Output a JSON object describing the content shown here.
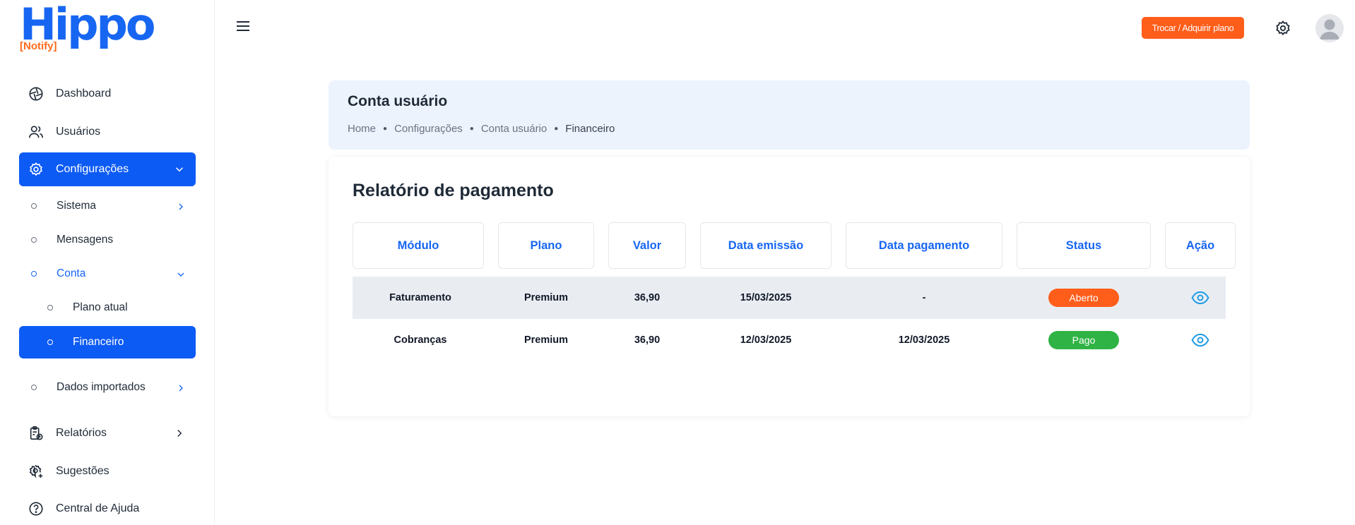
{
  "brand": {
    "name": "Hippo",
    "sub": "[Notify]"
  },
  "sidebar": {
    "items": [
      {
        "label": "Dashboard"
      },
      {
        "label": "Usuários"
      },
      {
        "label": "Configurações"
      },
      {
        "label": "Relatórios"
      },
      {
        "label": "Sugestões"
      },
      {
        "label": "Central de Ajuda"
      }
    ],
    "config_sub": {
      "sistema": "Sistema",
      "mensagens": "Mensagens",
      "conta": "Conta",
      "plano_atual": "Plano atual",
      "financeiro": "Financeiro",
      "dados_importados": "Dados importados"
    }
  },
  "header": {
    "cta_label": "Trocar / Adquirir plano"
  },
  "page": {
    "title": "Conta usuário",
    "breadcrumb": [
      "Home",
      "Configurações",
      "Conta usuário",
      "Financeiro"
    ]
  },
  "report": {
    "title": "Relatório de pagamento",
    "columns": [
      "Módulo",
      "Plano",
      "Valor",
      "Data emissão",
      "Data pagamento",
      "Status",
      "Ação"
    ],
    "rows": [
      {
        "modulo": "Faturamento",
        "plano": "Premium",
        "valor": "36,90",
        "emissao": "15/03/2025",
        "pagamento": "-",
        "status": "Aberto",
        "status_color": "#ff5d1a"
      },
      {
        "modulo": "Cobranças",
        "plano": "Premium",
        "valor": "36,90",
        "emissao": "12/03/2025",
        "pagamento": "12/03/2025",
        "status": "Pago",
        "status_color": "#2fb344"
      }
    ]
  },
  "colors": {
    "primary": "#0d5bf5",
    "accent": "#ff5d1a",
    "success": "#2fb344",
    "icon_eye": "#1e9be6"
  }
}
